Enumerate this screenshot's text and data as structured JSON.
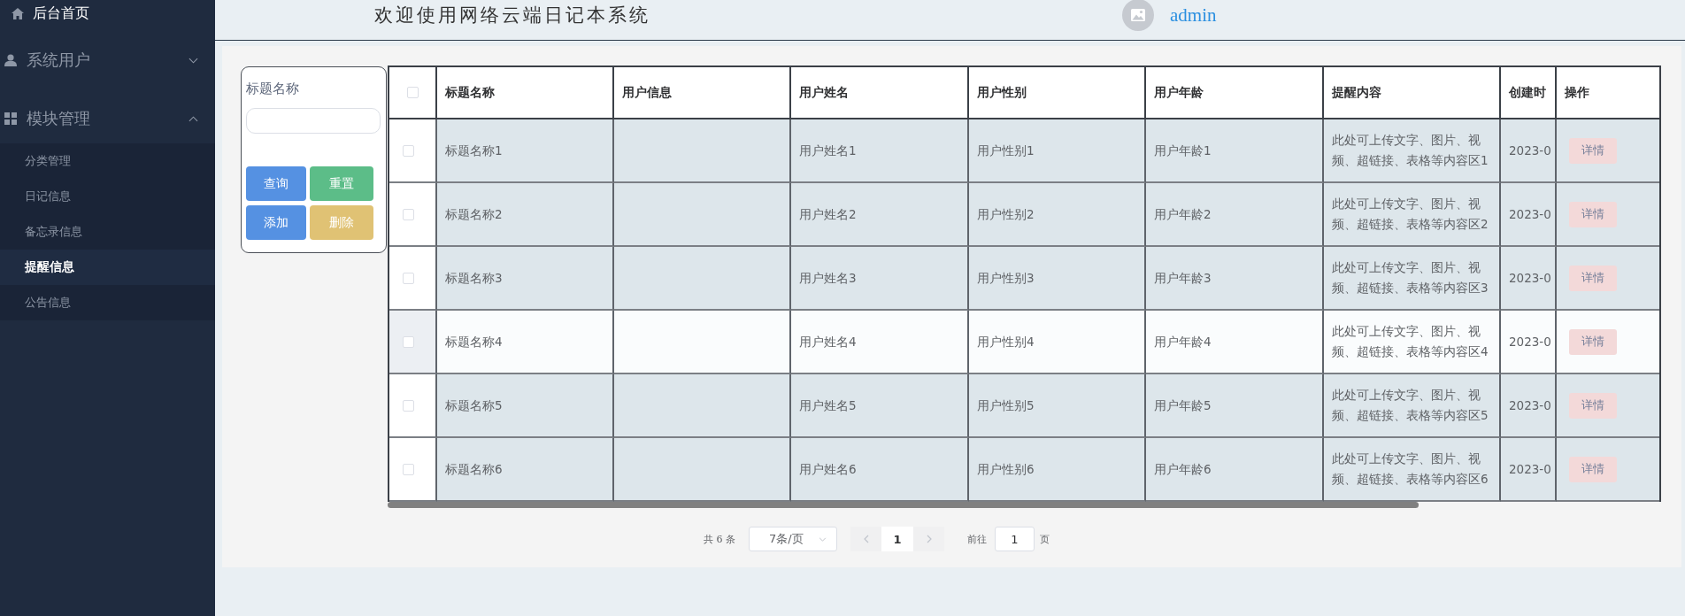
{
  "sidebar": {
    "home": {
      "label": "后台首页"
    },
    "menus": [
      {
        "label": "系统用户",
        "expanded": false
      },
      {
        "label": "模块管理",
        "expanded": true,
        "children": [
          {
            "label": "分类管理",
            "selected": false
          },
          {
            "label": "日记信息",
            "selected": false
          },
          {
            "label": "备忘录信息",
            "selected": false
          },
          {
            "label": "提醒信息",
            "selected": true
          },
          {
            "label": "公告信息",
            "selected": false
          }
        ]
      }
    ]
  },
  "header": {
    "title": "欢迎使用网络云端日记本系统",
    "username": "admin"
  },
  "search": {
    "label": "标题名称",
    "buttons": [
      {
        "label": "查询",
        "kind": "primary"
      },
      {
        "label": "重置",
        "kind": "success"
      },
      {
        "label": "添加",
        "kind": "primary"
      },
      {
        "label": "删除",
        "kind": "warning"
      }
    ]
  },
  "table": {
    "select_all_checked": false,
    "columns": [
      "标题名称",
      "用户信息",
      "用户姓名",
      "用户性别",
      "用户年龄",
      "提醒内容",
      "创建时",
      "操作"
    ],
    "rows": [
      {
        "checked": false,
        "hovered": false,
        "title": "标题名称1",
        "user_name": "用户姓名1",
        "user_gender": "用户性别1",
        "user_age": "用户年龄1",
        "reminder_content": "此处可上传文字、图片、视频、超链接、表格等内容区1",
        "column_7": "2023-0",
        "action": "详情"
      },
      {
        "checked": false,
        "hovered": false,
        "title": "标题名称2",
        "user_name": "用户姓名2",
        "user_gender": "用户性别2",
        "user_age": "用户年龄2",
        "reminder_content": "此处可上传文字、图片、视频、超链接、表格等内容区2",
        "column_7": "2023-0",
        "action": "详情"
      },
      {
        "checked": false,
        "hovered": false,
        "title": "标题名称3",
        "user_name": "用户姓名3",
        "user_gender": "用户性别3",
        "user_age": "用户年龄3",
        "reminder_content": "此处可上传文字、图片、视频、超链接、表格等内容区3",
        "column_7": "2023-0",
        "action": "详情"
      },
      {
        "checked": false,
        "hovered": true,
        "title": "标题名称4",
        "user_name": "用户姓名4",
        "user_gender": "用户性别4",
        "user_age": "用户年龄4",
        "reminder_content": "此处可上传文字、图片、视频、超链接、表格等内容区4",
        "column_7": "2023-0",
        "action": "详情"
      },
      {
        "checked": false,
        "hovered": false,
        "title": "标题名称5",
        "user_name": "用户姓名5",
        "user_gender": "用户性别5",
        "user_age": "用户年龄5",
        "reminder_content": "此处可上传文字、图片、视频、超链接、表格等内容区5",
        "column_7": "2023-0",
        "action": "详情"
      },
      {
        "checked": false,
        "hovered": false,
        "title": "标题名称6",
        "user_name": "用户姓名6",
        "user_gender": "用户性别6",
        "user_age": "用户年龄6",
        "reminder_content": "此处可上传文字、图片、视频、超链接、表格等内容区6",
        "column_7": "2023-0",
        "action": "详情"
      }
    ]
  },
  "pagination": {
    "total": "共 6 条",
    "page_size": "7条/页",
    "prev_disabled": true,
    "pages": [
      {
        "label": "1",
        "selected": true
      }
    ],
    "next_disabled": true,
    "goto_label": "前往",
    "goto_value": "1",
    "goto_suffix": "页"
  }
}
